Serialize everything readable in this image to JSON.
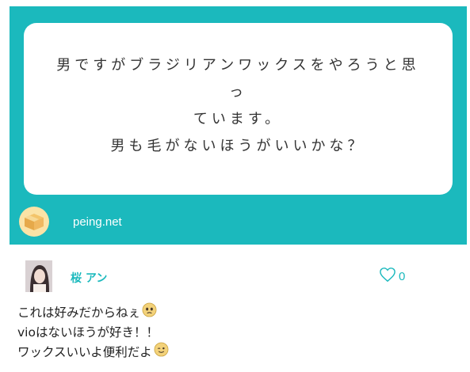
{
  "question": {
    "lines": [
      "男ですがブラジリアンワックスをやろうと思っ",
      "ています。",
      "男も毛がないほうがいいかな？"
    ],
    "brand_label": "peing.net",
    "card_color": "#1bb9bd"
  },
  "answer": {
    "author": "桜 アン",
    "like_count": "0",
    "lines": [
      {
        "text": "これは好みだからねぇ",
        "emoji": "pleading-face-icon"
      },
      {
        "text": "vioはないほうが好き！！",
        "emoji": ""
      },
      {
        "text": "ワックスいいよ便利だよ",
        "emoji": "winking-face-icon"
      }
    ],
    "accent": "#1bb9bd"
  }
}
